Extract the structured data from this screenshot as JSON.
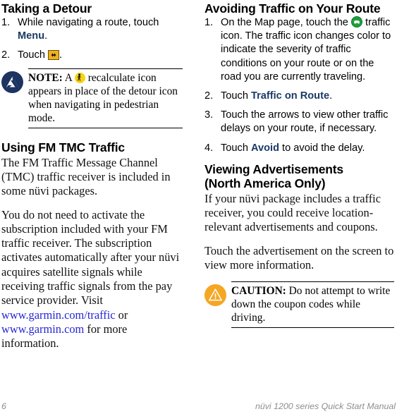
{
  "page": {
    "footer": {
      "page_number": "6",
      "manual_title": "nüvi 1200 series Quick Start Manual"
    }
  },
  "colors": {
    "bold_blue": "#1b3a66",
    "link_blue": "#2626d6",
    "note_icon_bg": "#1d3461",
    "caution_icon_bg": "#f5a623",
    "detour_icon_bg": "#f2b01e",
    "pedestrian_icon_bg": "#f5d316",
    "traffic_icon_bg": "#1e9e3e",
    "footer_gray": "#8d8d8d"
  },
  "left_column": {
    "section1": {
      "heading": "Taking a Detour",
      "steps": [
        {
          "number": "1.",
          "text_before": "While navigating a route, touch ",
          "bold_term": "Menu",
          "text_after": "."
        },
        {
          "number": "2.",
          "text_before": "Touch ",
          "icon": "detour-icon",
          "text_after": "."
        }
      ],
      "note": {
        "icon": "garmin-note-icon",
        "label": "NOTE:",
        "text_before": " A ",
        "inline_icon": "pedestrian-icon",
        "text_after": " recalculate icon appears in place of the detour icon when navigating in pedestrian mode."
      }
    },
    "section2": {
      "heading": "Using FM TMC Traffic",
      "paragraph1": "The FM Traffic Message Channel (TMC) traffic receiver is included in some nüvi packages.",
      "paragraph2": {
        "part1": "You do not need to activate the subscription included with your FM traffic receiver. The subscription activates automatically after your nüvi acquires satellite signals while receiving traffic signals from the pay service provider. Visit ",
        "link1": "www.garmin.com/traffic",
        "part2": " or ",
        "link2": "www.garmin.com",
        "part3": " for more information."
      }
    }
  },
  "right_column": {
    "section1": {
      "heading": "Avoiding Traffic on Your Route",
      "steps": [
        {
          "number": "1.",
          "text_before": "On the Map page, touch the ",
          "icon": "traffic-icon",
          "text_after": " traffic icon. The traffic icon changes color to indicate the severity of traffic conditions on your route or on the road you are currently traveling."
        },
        {
          "number": "2.",
          "text_before": "Touch ",
          "bold_term": "Traffic on Route",
          "text_after": "."
        },
        {
          "number": "3.",
          "text_before": "Touch the arrows to view other traffic delays on your route, if necessary.",
          "bold_term": "",
          "text_after": ""
        },
        {
          "number": "4.",
          "text_before": "Touch ",
          "bold_term": "Avoid",
          "text_after": " to avoid the delay."
        }
      ]
    },
    "section2": {
      "heading_line1": "Viewing Advertisements",
      "heading_line2": "(North America Only)",
      "paragraph1": "If your nüvi package includes a traffic receiver, you could receive location-relevant advertisements and coupons.",
      "paragraph2": "Touch the advertisement on the screen to view more information.",
      "caution": {
        "icon": "caution-icon",
        "label": "CAUTION:",
        "text": " Do not attempt to write down the coupon codes while driving."
      }
    }
  }
}
